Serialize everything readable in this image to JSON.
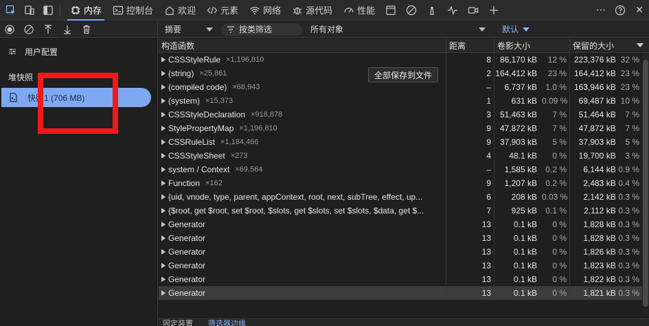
{
  "top_tabs": {
    "memory": "内存",
    "console": "控制台",
    "welcome": "欢迎",
    "elements": "元素",
    "network": "网络",
    "sources": "源代码",
    "performance": "性能"
  },
  "toolbar2": {
    "view_select": "摘要",
    "filter_label": "按类筛选",
    "objects_select": "所有对象",
    "default_select": "默认"
  },
  "left_panel": {
    "profile_label": "用户配置",
    "section_label": "堆快照",
    "snapshot_label": "快照1 (706 MB)"
  },
  "table": {
    "headers": {
      "constructor": "构造函数",
      "distance": "距离",
      "shallow": "卷影大小",
      "retained": "保留的大小"
    },
    "save_button": "全部保存到文件",
    "rows": [
      {
        "name": "CSSStyleRule",
        "count": "×1,196,810",
        "distance": "8",
        "shallow": "86,170 kB",
        "shallow_pct": "12 %",
        "retained": "223,376 kB",
        "retained_pct": "32 %"
      },
      {
        "name": "(string)",
        "count": "×25,861",
        "distance": "2",
        "shallow": "164,412 kB",
        "shallow_pct": "23 %",
        "retained": "164,412 kB",
        "retained_pct": "23 %"
      },
      {
        "name": "(compiled code)",
        "count": "×68,943",
        "distance": "–",
        "shallow": "6,737 kB",
        "shallow_pct": "1.0 %",
        "retained": "163,946 kB",
        "retained_pct": "23 %"
      },
      {
        "name": "(system)",
        "count": "×15,373",
        "distance": "1",
        "shallow": "631 kB",
        "shallow_pct": "0.09 %",
        "retained": "69,487 kB",
        "retained_pct": "10 %"
      },
      {
        "name": "CSSStyleDeclaration",
        "count": "×918,878",
        "distance": "3",
        "shallow": "51,463 kB",
        "shallow_pct": "7 %",
        "retained": "51,464 kB",
        "retained_pct": "7 %"
      },
      {
        "name": "StylePropertyMap",
        "count": "×1,196,810",
        "distance": "9",
        "shallow": "47,872 kB",
        "shallow_pct": "7 %",
        "retained": "47,872 kB",
        "retained_pct": "7 %"
      },
      {
        "name": "CSSRuleList",
        "count": "×1,184,466",
        "distance": "9",
        "shallow": "37,903 kB",
        "shallow_pct": "5 %",
        "retained": "37,903 kB",
        "retained_pct": "5 %"
      },
      {
        "name": "CSSStyleSheet",
        "count": "×273",
        "distance": "4",
        "shallow": "48.1 kB",
        "shallow_pct": "0 %",
        "retained": "19,700 kB",
        "retained_pct": "3 %"
      },
      {
        "name": "system / Context",
        "count": "×69,564",
        "distance": "–",
        "shallow": "1,585 kB",
        "shallow_pct": "0.2 %",
        "retained": "6,144 kB",
        "retained_pct": "0.9 %"
      },
      {
        "name": "Function",
        "count": "×162",
        "distance": "9",
        "shallow": "1,207 kB",
        "shallow_pct": "0.2 %",
        "retained": "2,483 kB",
        "retained_pct": "0.4 %"
      },
      {
        "name": "{uid, vnode, type, parent, appContext, root, next, subTree, effect, up...",
        "count": "",
        "distance": "6",
        "shallow": "208 kB",
        "shallow_pct": "0.03 %",
        "retained": "2,142 kB",
        "retained_pct": "0.3 %"
      },
      {
        "name": "{$root, get $root, set $root, $slots, get $slots, set $slots, $data, get $...",
        "count": "",
        "distance": "7",
        "shallow": "925 kB",
        "shallow_pct": "0.1 %",
        "retained": "2,112 kB",
        "retained_pct": "0.3 %"
      },
      {
        "name": "Generator",
        "count": "",
        "distance": "13",
        "shallow": "0.1 kB",
        "shallow_pct": "0 %",
        "retained": "1,828 kB",
        "retained_pct": "0.3 %"
      },
      {
        "name": "Generator",
        "count": "",
        "distance": "13",
        "shallow": "0.1 kB",
        "shallow_pct": "0 %",
        "retained": "1,828 kB",
        "retained_pct": "0.3 %"
      },
      {
        "name": "Generator",
        "count": "",
        "distance": "13",
        "shallow": "0.1 kB",
        "shallow_pct": "0 %",
        "retained": "1,826 kB",
        "retained_pct": "0.3 %"
      },
      {
        "name": "Generator",
        "count": "",
        "distance": "13",
        "shallow": "0.1 kB",
        "shallow_pct": "0 %",
        "retained": "1,823 kB",
        "retained_pct": "0.3 %"
      },
      {
        "name": "Generator",
        "count": "",
        "distance": "13",
        "shallow": "0.1 kB",
        "shallow_pct": "0 %",
        "retained": "1,822 kB",
        "retained_pct": "0.3 %"
      },
      {
        "name": "Generator",
        "count": "",
        "distance": "13",
        "shallow": "0.1 kB",
        "shallow_pct": "0 %",
        "retained": "1,821 kB",
        "retained_pct": "0.3 %"
      }
    ]
  },
  "bottom": {
    "tab1": "固定装置",
    "tab2": "筛选器边缘"
  },
  "colors": {
    "accent": "#7fa8f2",
    "annotation_red": "#f01a1a"
  }
}
